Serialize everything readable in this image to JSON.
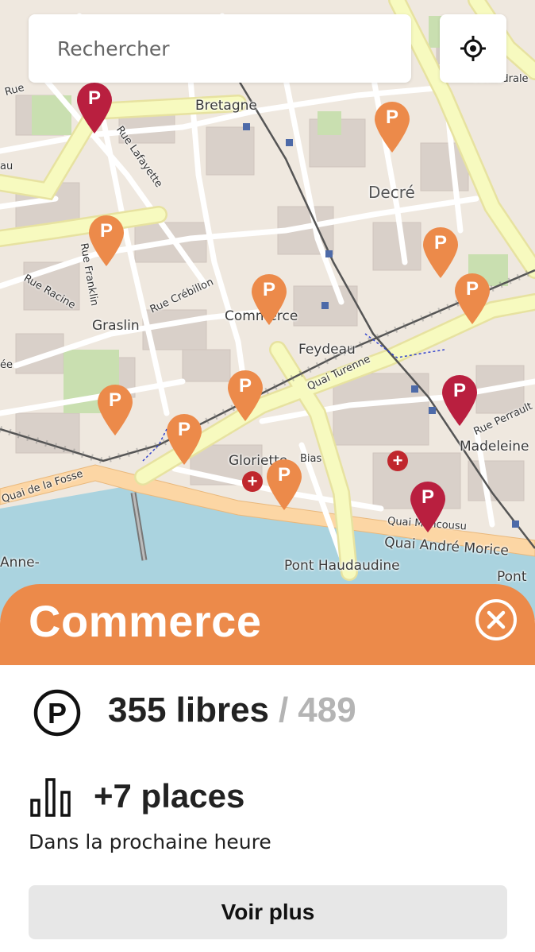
{
  "search": {
    "placeholder": "Rechercher"
  },
  "map": {
    "labels": {
      "bretagne": "Bretagne",
      "decre": "Decré",
      "graslin": "Graslin",
      "commerce": "Commerce",
      "feydeau": "Feydeau",
      "madeleine": "Madeleine",
      "gloriette": "Gloriette",
      "pont_haudaudine": "Pont Haudaudine",
      "rue_lafayette": "Rue Lafayette",
      "rue_franklin": "Rue Franklin",
      "rue_racine": "Rue Racine",
      "rue_crebillon": "Rue Crébillon",
      "quai_turenne": "Quai Turenne",
      "quai_de_la_fosse": "Quai de la Fosse",
      "quai_andre_morice": "Quai André Morice",
      "quai_moncousu": "Quai Moncousu",
      "rue_perrault": "Rue Perrault",
      "bias": "Bias",
      "cathedrale": "Cathédrale",
      "anne": "Anne-",
      "pont_right": "Pont",
      "fragment_au": "au",
      "fragment_ee": "ée",
      "fragment_rue": "Rue"
    },
    "marker_letter": "P",
    "hospital_symbol": "+",
    "colors": {
      "marker_orange": "#ec8a4a",
      "marker_red": "#b91f3f",
      "water": "#aad3df",
      "major_road": "#f7fabf",
      "quay": "#fcd6a4"
    }
  },
  "sheet": {
    "title": "Commerce",
    "available": "355 libres",
    "separator": "/",
    "total": "489",
    "trend": "+7 places",
    "trend_subtitle": "Dans la prochaine heure",
    "more_label": "Voir plus",
    "accent_color": "#ec8a4a"
  },
  "icons": {
    "locate": "crosshair-icon",
    "close": "close-circle-icon",
    "parking": "parking-circle-icon",
    "trend": "bar-chart-icon"
  }
}
